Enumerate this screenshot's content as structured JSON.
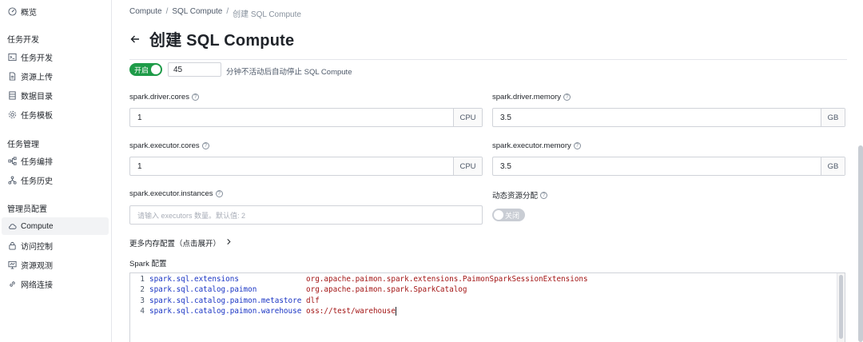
{
  "sidebar": {
    "overview": {
      "label": "概览",
      "icon": "dashboard-icon"
    },
    "group_dev": {
      "title": "任务开发"
    },
    "dev_items": [
      {
        "label": "任务开发",
        "icon": "terminal-icon"
      },
      {
        "label": "资源上传",
        "icon": "file-icon"
      },
      {
        "label": "数据目录",
        "icon": "catalog-icon"
      },
      {
        "label": "任务模板",
        "icon": "gear-icon"
      }
    ],
    "group_ops": {
      "title": "任务管理"
    },
    "ops_items": [
      {
        "label": "任务编排",
        "icon": "workflow-icon"
      },
      {
        "label": "任务历史",
        "icon": "history-icon"
      }
    ],
    "group_admin": {
      "title": "管理员配置"
    },
    "admin_items": [
      {
        "label": "Compute",
        "icon": "cloud-icon",
        "active": true
      },
      {
        "label": "访问控制",
        "icon": "lock-icon"
      },
      {
        "label": "资源观测",
        "icon": "monitor-icon"
      },
      {
        "label": "网络连接",
        "icon": "link-icon"
      }
    ]
  },
  "breadcrumb": {
    "items": [
      "Compute",
      "SQL Compute",
      "创建 SQL Compute"
    ],
    "separator": "/"
  },
  "page_title": "创建 SQL Compute",
  "auto_stop": {
    "toggle_label": "开启",
    "minutes": "45",
    "description": "分钟不活动后自动停止 SQL Compute"
  },
  "form": {
    "driver_cores": {
      "label": "spark.driver.cores",
      "value": "1",
      "unit": "CPU"
    },
    "driver_memory": {
      "label": "spark.driver.memory",
      "value": "3.5",
      "unit": "GB"
    },
    "executor_cores": {
      "label": "spark.executor.cores",
      "value": "1",
      "unit": "CPU"
    },
    "executor_memory": {
      "label": "spark.executor.memory",
      "value": "3.5",
      "unit": "GB"
    },
    "executor_instances": {
      "label": "spark.executor.instances",
      "placeholder": "请输入 executors 数量。默认值: 2"
    },
    "dynamic_allocation": {
      "label": "动态资源分配",
      "toggle_label": "关闭"
    }
  },
  "expand_label": "更多内存配置（点击展开）",
  "spark_config": {
    "label": "Spark 配置",
    "lines": [
      {
        "num": "1",
        "key": "spark.sql.extensions",
        "value": "org.apache.paimon.spark.extensions.PaimonSparkSessionExtensions"
      },
      {
        "num": "2",
        "key": "spark.sql.catalog.paimon",
        "value": "org.apache.paimon.spark.SparkCatalog"
      },
      {
        "num": "3",
        "key": "spark.sql.catalog.paimon.metastore",
        "value": "dlf"
      },
      {
        "num": "4",
        "key": "spark.sql.catalog.paimon.warehouse",
        "value": "oss://test/warehouse"
      }
    ]
  },
  "colors": {
    "toggle_on": "#1e9b48",
    "code_key": "#1a35c4",
    "code_value": "#a31515"
  }
}
